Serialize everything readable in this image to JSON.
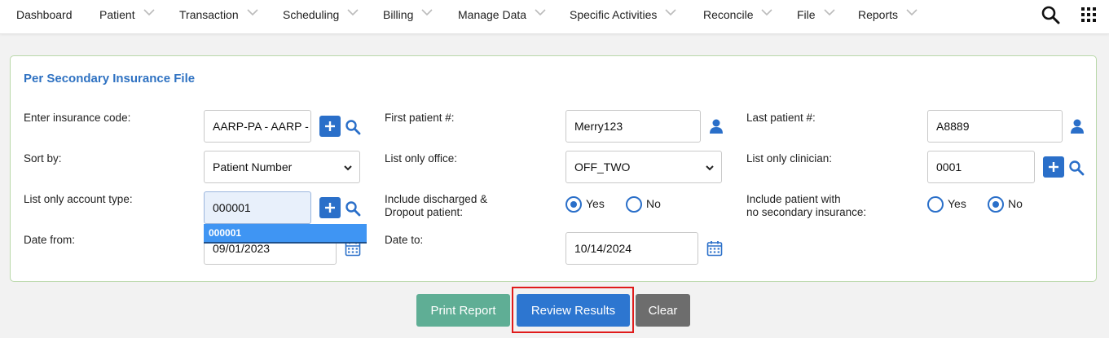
{
  "nav": {
    "items": [
      {
        "label": "Dashboard",
        "dropdown": false
      },
      {
        "label": "Patient",
        "dropdown": true
      },
      {
        "label": "Transaction",
        "dropdown": true
      },
      {
        "label": "Scheduling",
        "dropdown": true
      },
      {
        "label": "Billing",
        "dropdown": true
      },
      {
        "label": "Manage Data",
        "dropdown": true
      },
      {
        "label": "Specific Activities",
        "dropdown": true
      },
      {
        "label": "Reconcile",
        "dropdown": true
      },
      {
        "label": "File",
        "dropdown": true
      },
      {
        "label": "Reports",
        "dropdown": true
      }
    ],
    "icons": [
      "search-icon",
      "apps-grid-icon"
    ]
  },
  "panel": {
    "title": "Per Secondary Insurance File",
    "insurance_code": {
      "label": "Enter insurance code:",
      "value": "AARP-PA - AARP -"
    },
    "first_patient": {
      "label": "First patient #:",
      "value": "Merry123"
    },
    "last_patient": {
      "label": "Last patient #:",
      "value": "A8889"
    },
    "sort_by": {
      "label": "Sort by:",
      "value": "Patient Number"
    },
    "list_office": {
      "label": "List only office:",
      "value": "OFF_TWO"
    },
    "list_clinician": {
      "label": "List only clinician:",
      "value": "0001"
    },
    "account_type": {
      "label": "List only account type:",
      "value": "000001",
      "suggestion": "000001"
    },
    "include_discharged": {
      "label_line1": "Include discharged &",
      "label_line2": "Dropout patient:",
      "yes": "Yes",
      "no": "No",
      "selected": "Yes"
    },
    "include_no_secondary": {
      "label_line1": "Include patient with",
      "label_line2": "no secondary insurance:",
      "yes": "Yes",
      "no": "No",
      "selected": "No"
    },
    "date_from": {
      "label": "Date from:",
      "value": "09/01/2023"
    },
    "date_to": {
      "label": "Date to:",
      "value": "10/14/2024"
    }
  },
  "buttons": {
    "print": "Print Report",
    "review": "Review Results",
    "clear": "Clear"
  },
  "colors": {
    "accent": "#2a6fc9",
    "title": "#2f72c2",
    "print_button": "#5fae95",
    "clear_button": "#6d6d6d",
    "highlight": "#e01b1b"
  }
}
